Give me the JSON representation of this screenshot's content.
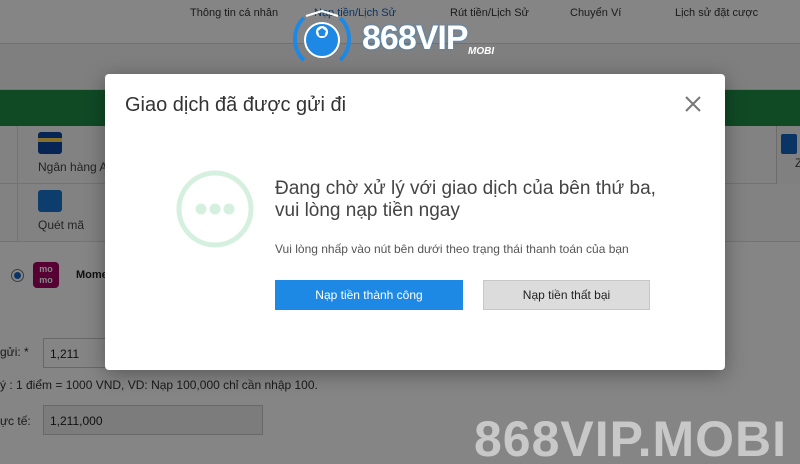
{
  "topnav": {
    "items": [
      "Thông tin cá nhân",
      "Nạp tiền/Lịch Sử",
      "Rút tiền/Lịch Sử",
      "Chuyển Ví",
      "Lịch sử đặt cược"
    ]
  },
  "brand": {
    "name": "868VIP",
    "suffix": "MOBI",
    "color": "#1e88e5"
  },
  "methods": {
    "bank_label": "Ngân hàng A",
    "scan_label": "Quét mã",
    "right_partial_label": "Z"
  },
  "momo": {
    "logo_text_top": "mo",
    "logo_text_bottom": "mo",
    "label": "Mome"
  },
  "form": {
    "amount_label": "gửi: *",
    "amount_value": "1,211",
    "hint": "ý : 1 điểm = 1000 VND, VD: Nạp 100,000 chỉ cần nhập 100.",
    "actual_label": "ực tế:",
    "actual_value": "1,211,000"
  },
  "watermark": "868VIP.MOBI",
  "modal": {
    "title": "Giao dịch đã được gửi đi",
    "message": "Đang chờ xử lý với giao dịch của bên thứ ba, vui lòng nạp tiền ngay",
    "sub_message": "Vui lòng nhấp vào nút bên dưới theo trạng thái thanh toán của bạn",
    "success_button": "Nạp tiền thành công",
    "fail_button": "Nạp tiền thất bại",
    "accent_color": "#1e88e5",
    "status_color": "#d5f0de"
  }
}
